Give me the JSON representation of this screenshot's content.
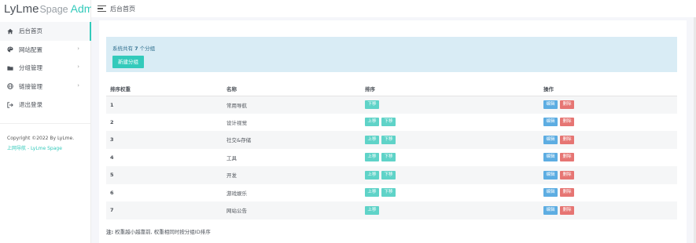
{
  "logo": {
    "part1": "LyLme",
    "part2": "Spage",
    "part3": "Admin"
  },
  "topbar": {
    "title": "后台首页"
  },
  "sidebar": {
    "items": [
      {
        "label": "后台首页",
        "icon": "home-icon",
        "active": true
      },
      {
        "label": "网站配置",
        "icon": "palette-icon",
        "has_submenu": true
      },
      {
        "label": "分组管理",
        "icon": "folder-icon",
        "has_submenu": true
      },
      {
        "label": "链接管理",
        "icon": "globe-icon",
        "has_submenu": true
      },
      {
        "label": "退出登录",
        "icon": "logout-icon"
      }
    ],
    "footer_copyright": "Copyright ©2022 By LyLme.",
    "footer_link": "上网导航 - LyLme Spage"
  },
  "alert": {
    "prefix": "系统共有 ",
    "count": "7",
    "suffix": " 个分组",
    "button": "新建分组"
  },
  "table": {
    "headers": [
      "排序权重",
      "名称",
      "排序",
      "操作"
    ],
    "rows": [
      {
        "weight": "1",
        "name": "常用导航",
        "sort": [
          "下移"
        ],
        "actions": [
          "编辑",
          "删除"
        ]
      },
      {
        "weight": "2",
        "name": "设计视觉",
        "sort": [
          "上移",
          "下移"
        ],
        "actions": [
          "编辑",
          "删除"
        ]
      },
      {
        "weight": "3",
        "name": "社交&存储",
        "sort": [
          "上移",
          "下移"
        ],
        "actions": [
          "编辑",
          "删除"
        ]
      },
      {
        "weight": "4",
        "name": "工具",
        "sort": [
          "上移",
          "下移"
        ],
        "actions": [
          "编辑",
          "删除"
        ]
      },
      {
        "weight": "5",
        "name": "开发",
        "sort": [
          "上移",
          "下移"
        ],
        "actions": [
          "编辑",
          "删除"
        ]
      },
      {
        "weight": "6",
        "name": "游戏娱乐",
        "sort": [
          "上移",
          "下移"
        ],
        "actions": [
          "编辑",
          "删除"
        ]
      },
      {
        "weight": "7",
        "name": "网站公告",
        "sort": [
          "上移"
        ],
        "actions": [
          "编辑",
          "删除"
        ]
      }
    ]
  },
  "note": {
    "label": "注:",
    "text": " 权重越小越靠前, 权重相同时按分组ID排序"
  },
  "colors": {
    "accent": "#33cabb",
    "alert_bg": "#d9ecf5",
    "edit": "#5dade2",
    "delete": "#e67573"
  }
}
